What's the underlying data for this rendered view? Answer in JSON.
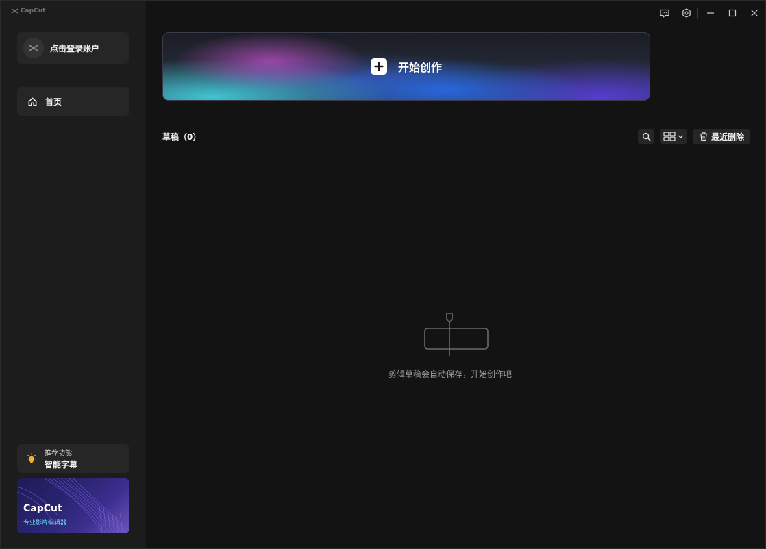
{
  "app": {
    "name": "CapCut"
  },
  "sidebar": {
    "account_label": "点击登录账户",
    "nav": [
      {
        "label": "首页",
        "icon": "home-icon"
      }
    ],
    "recommend": {
      "small": "推荐功能",
      "big": "智能字幕",
      "icon": "lightbulb-icon"
    },
    "promo": {
      "title": "CapCut",
      "subtitle": "专业影片编辑器"
    }
  },
  "window_controls": [
    "feedback-icon",
    "settings-icon",
    "minimize-icon",
    "maximize-icon",
    "close-icon"
  ],
  "hero": {
    "label": "开始创作",
    "icon": "plus-icon"
  },
  "drafts": {
    "title": "草稿（0）",
    "recent_deleted_label": "最近删除",
    "empty_message": "剪辑草稿会自动保存，开始创作吧"
  },
  "colors": {
    "background": "#131313",
    "sidebar": "#1c1c1c",
    "card": "#262626",
    "accent_cyan": "#62e0f0",
    "lightbulb": "#f0b429"
  }
}
